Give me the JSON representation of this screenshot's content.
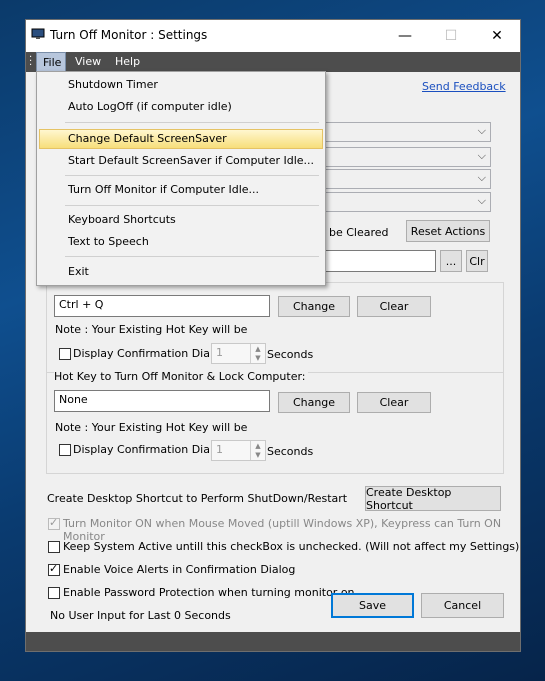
{
  "window": {
    "title": "Turn Off Monitor : Settings",
    "minimize_glyph": "—",
    "maximize_glyph": "☐",
    "close_glyph": "✕"
  },
  "menubar": {
    "items": [
      {
        "label": "File"
      },
      {
        "label": "View"
      },
      {
        "label": "Help"
      }
    ]
  },
  "file_menu": {
    "items": [
      {
        "label": "Shutdown Timer"
      },
      {
        "label": "Auto LogOff (if computer idle)"
      },
      {
        "label": "Change Default ScreenSaver"
      },
      {
        "label": "Start Default ScreenSaver if Computer Idle..."
      },
      {
        "label": "Turn Off Monitor if Computer Idle..."
      },
      {
        "label": "Keyboard Shortcuts"
      },
      {
        "label": "Text to Speech"
      },
      {
        "label": "Exit"
      }
    ],
    "highlighted_index": 2
  },
  "header": {
    "send_feedback": "Send Feedback"
  },
  "actions": {
    "partial_text": "be Cleared",
    "reset_actions": "Reset Actions",
    "browse_button": "...",
    "clr_button": "Clr"
  },
  "hotkey1": {
    "value": "Ctrl + Q",
    "change": "Change",
    "clear": "Clear",
    "note": "Note : Your Existing Hot Key will be",
    "confirm_label": "Display Confirmation Dialog",
    "seconds_value": "1",
    "seconds_label": "Seconds"
  },
  "hotkey2": {
    "title": "Hot Key to Turn Off Monitor & Lock Computer:",
    "value": "None",
    "change": "Change",
    "clear": "Clear",
    "note": "Note : Your Existing Hot Key will be",
    "confirm_label": "Display Confirmation Dialog",
    "seconds_value": "1",
    "seconds_label": "Seconds"
  },
  "bottom": {
    "shortcut_text": "Create Desktop Shortcut to Perform ShutDown/Restart",
    "shortcut_button": "Create Desktop Shortcut",
    "opt_monitor_on": "Turn Monitor ON when Mouse Moved (uptill Windows XP), Keypress can Turn ON Monitor",
    "opt_keep_active": "Keep System Active untill this checkBox is unchecked.  (Will not affect my Settings)",
    "opt_voice_alerts": "Enable Voice Alerts in Confirmation Dialog",
    "opt_password": "Enable Password Protection when turning monitor on",
    "idle_status": "No User Input for Last 0 Seconds",
    "save": "Save",
    "cancel": "Cancel"
  },
  "checkboxes": {
    "monitor_on": true,
    "keep_active": false,
    "voice_alerts": true,
    "password": false,
    "confirm1": false,
    "confirm2": false
  },
  "colors": {
    "menubar": "#4d4d4d",
    "link": "#1a4fbf",
    "highlight": "#f7de7b",
    "accent": "#0078d7"
  }
}
